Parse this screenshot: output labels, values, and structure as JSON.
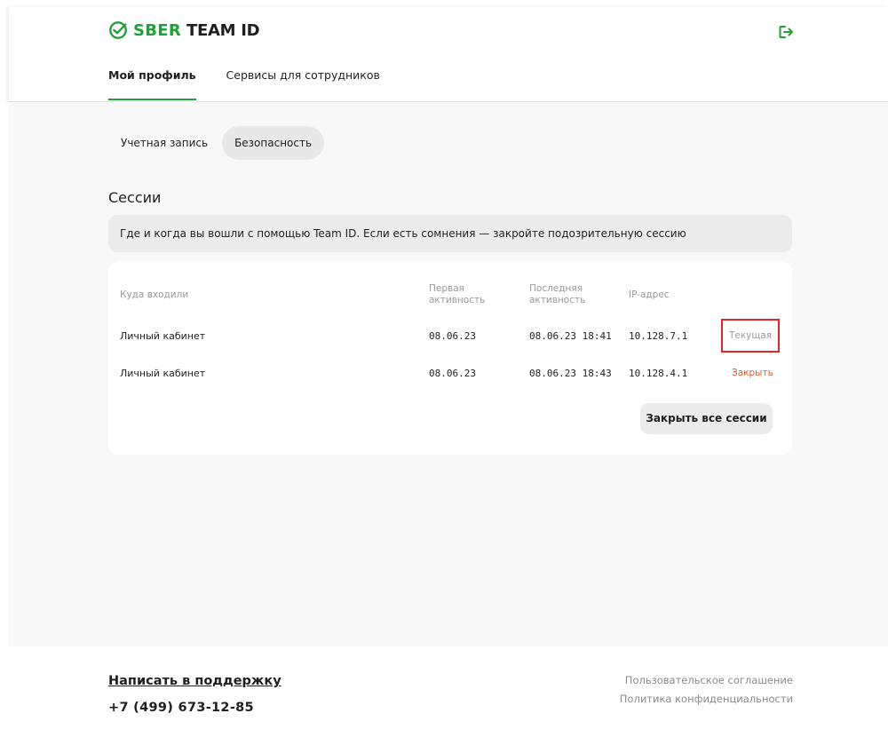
{
  "header": {
    "logo_brand": "SBER",
    "logo_product": "TEAM ID",
    "brand_color": "#21A038",
    "logout_icon": "logout-icon",
    "tabs": [
      {
        "label": "Мой профиль",
        "active": true
      },
      {
        "label": "Сервисы для сотрудников",
        "active": false
      }
    ]
  },
  "subtabs": [
    {
      "label": "Учетная запись",
      "active": false
    },
    {
      "label": "Безопасность",
      "active": true
    }
  ],
  "sessions": {
    "title": "Сессии",
    "info": "Где и когда вы вошли с помощью Team ID. Если есть сомнения — закройте подозрительную сессию",
    "columns": {
      "place": "Куда входили",
      "first_line1": "Первая",
      "first_line2": "активность",
      "last_line1": "Последняя",
      "last_line2": "активность",
      "ip": "IP-адрес"
    },
    "rows": [
      {
        "place": "Личный кабинет",
        "first": "08.06.23",
        "last": "08.06.23 18:41",
        "ip": "10.128.7.1",
        "action": "Текущая"
      },
      {
        "place": "Личный кабинет",
        "first": "08.06.23",
        "last": "08.06.23 18:43",
        "ip": "10.128.4.1",
        "action": "Закрыть"
      }
    ],
    "close_all": "Закрыть все сессии",
    "accent_close_color": "#E0592A",
    "highlight_color": "#E2262A"
  },
  "footer": {
    "support": "Написать в поддержку",
    "phone": "+7 (499) 673-12-85",
    "links": [
      "Пользовательское соглашение",
      "Политика конфиденциальности"
    ]
  }
}
